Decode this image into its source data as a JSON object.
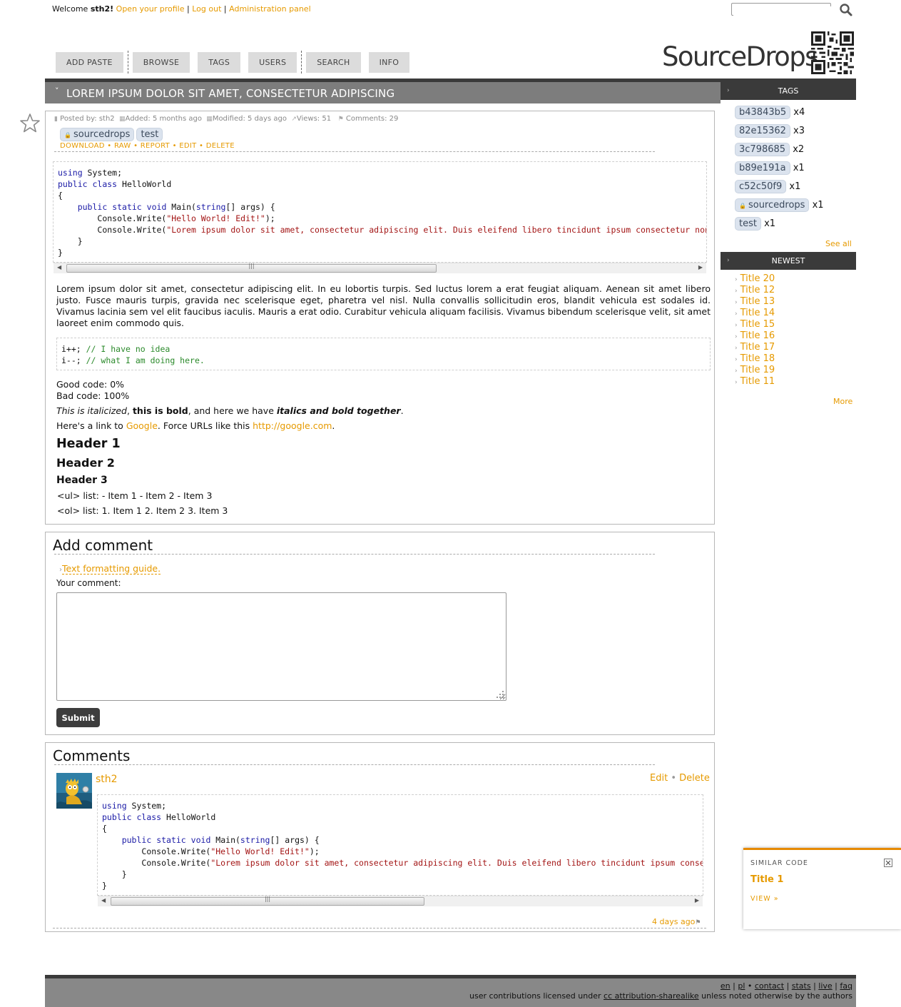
{
  "topbar": {
    "welcome": "Welcome ",
    "username": "sth2",
    "exclaim": "!",
    "links": [
      "Open your profile",
      "Log out",
      "Administration panel"
    ],
    "separator": "|"
  },
  "search": {
    "placeholder": "",
    "value": ""
  },
  "nav": [
    "ADD PASTE",
    "BROWSE",
    "TAGS",
    "USERS",
    "SEARCH",
    "INFO"
  ],
  "logo": "SourceDrops",
  "paste": {
    "title": "LOREM IPSUM DOLOR SIT AMET, CONSECTETUR ADIPISCING",
    "meta": {
      "posted_by": "Posted by: sth2",
      "added": "Added: 5 months ago",
      "modified": "Modified: 5 days ago",
      "views": "Views: 51",
      "comments": "Comments: 29"
    },
    "tags": [
      "sourcedrops",
      "test"
    ],
    "actions": [
      "DOWNLOAD",
      "RAW",
      "REPORT",
      "EDIT",
      "DELETE"
    ],
    "code": {
      "l1_kw": "using",
      "l1_rest": " System;",
      "l2_kw1": "public",
      "l2_kw2": "class",
      "l2_rest": " HelloWorld",
      "l3": "{",
      "l4_kw1": "public",
      "l4_kw2": "static",
      "l4_kw3": "void",
      "l4_mid": " Main(",
      "l4_kw4": "string",
      "l4_rest": "[] args) {",
      "l5_pre": "Console.Write(",
      "l5_str": "\"Hello World! Edit!\"",
      "l5_post": ");",
      "l6_pre": "Console.Write(",
      "l6_str": "\"Lorem ipsum dolor sit amet, consectetur adipiscing elit. Duis eleifend libero tincidunt ipsum consectetur non",
      "l7": "}",
      "l8": "}"
    },
    "paragraph": "Lorem ipsum dolor sit amet, consectetur adipiscing elit. In eu lobortis turpis. Sed luctus lorem a erat feugiat aliquam. Aenean sit amet libero justo. Fusce mauris turpis, gravida nec scelerisque eget, pharetra vel nisl. Nulla convallis sollicitudin eros, blandit vehicula est sodales id. Vivamus lacinia sem vel elit faucibus iaculis. Mauris a erat odio. Curabitur vehicula aliquam facilisis. Vivamus bibendum scelerisque velit, sit amet laoreet enim commodo quis.",
    "snippet": {
      "l1_code": "i++; ",
      "l1_cmt": "// I have no idea",
      "l2_code": "i--; ",
      "l2_cmt": "// what I am doing here."
    },
    "good_code": "Good code: 0%",
    "bad_code": "Bad code: 100%",
    "format_line": {
      "italic": "This is italicized",
      "sep1": ", ",
      "bold": "this is bold",
      "mid": ", and here we have ",
      "bolditalic": "italics and bold together",
      "end": "."
    },
    "link_line": {
      "pre": "Here's a link to ",
      "link1": "Google",
      "mid": ". Force URLs like this ",
      "link2": "http://google.com",
      "end": "."
    },
    "header1": "Header 1",
    "header2": "Header 2",
    "header3": "Header 3",
    "ul_line": "<ul> list: - Item 1 - Item 2 - Item 3",
    "ol_line": "<ol> list: 1. Item 1 2. Item 2 3. Item 3"
  },
  "sidebar": {
    "tags_title": "TAGS",
    "tags": [
      {
        "name": "b43843b5",
        "count": "x4"
      },
      {
        "name": "82e15362",
        "count": "x3"
      },
      {
        "name": "3c798685",
        "count": "x2"
      },
      {
        "name": "b89e191a",
        "count": "x1"
      },
      {
        "name": "c52c50f9",
        "count": "x1"
      },
      {
        "name": "sourcedrops",
        "count": "x1"
      },
      {
        "name": "test",
        "count": "x1"
      }
    ],
    "see_all": "See all",
    "newest_title": "NEWEST",
    "newest": [
      "Title 20",
      "Title 12",
      "Title 13",
      "Title 14",
      "Title 15",
      "Title 16",
      "Title 17",
      "Title 18",
      "Title 19",
      "Title 11"
    ],
    "more": "More"
  },
  "comment_form": {
    "title": "Add comment",
    "guide": "Text formatting guide.",
    "label": "Your comment:",
    "value": "",
    "submit": "Submit"
  },
  "comments": {
    "title": "Comments",
    "items": [
      {
        "user": "sth2",
        "edit": "Edit",
        "delete": "Delete",
        "time": "4 days ago"
      }
    ]
  },
  "similar": {
    "heading": "SIMILAR CODE",
    "title": "Title 1",
    "view": "VIEW »"
  },
  "footer": {
    "links": [
      "en",
      "pl",
      "contact",
      "stats",
      "live",
      "faq"
    ],
    "license_pre": "user contributions licensed under ",
    "license_link": "cc attribution-sharealike",
    "license_post": " unless noted otherwise by the authors"
  },
  "colors": {
    "accent": "#e69a00",
    "dark": "#3a3a3a",
    "titlebar": "#7d7d7d",
    "tag_bg": "#dbe3ee"
  }
}
